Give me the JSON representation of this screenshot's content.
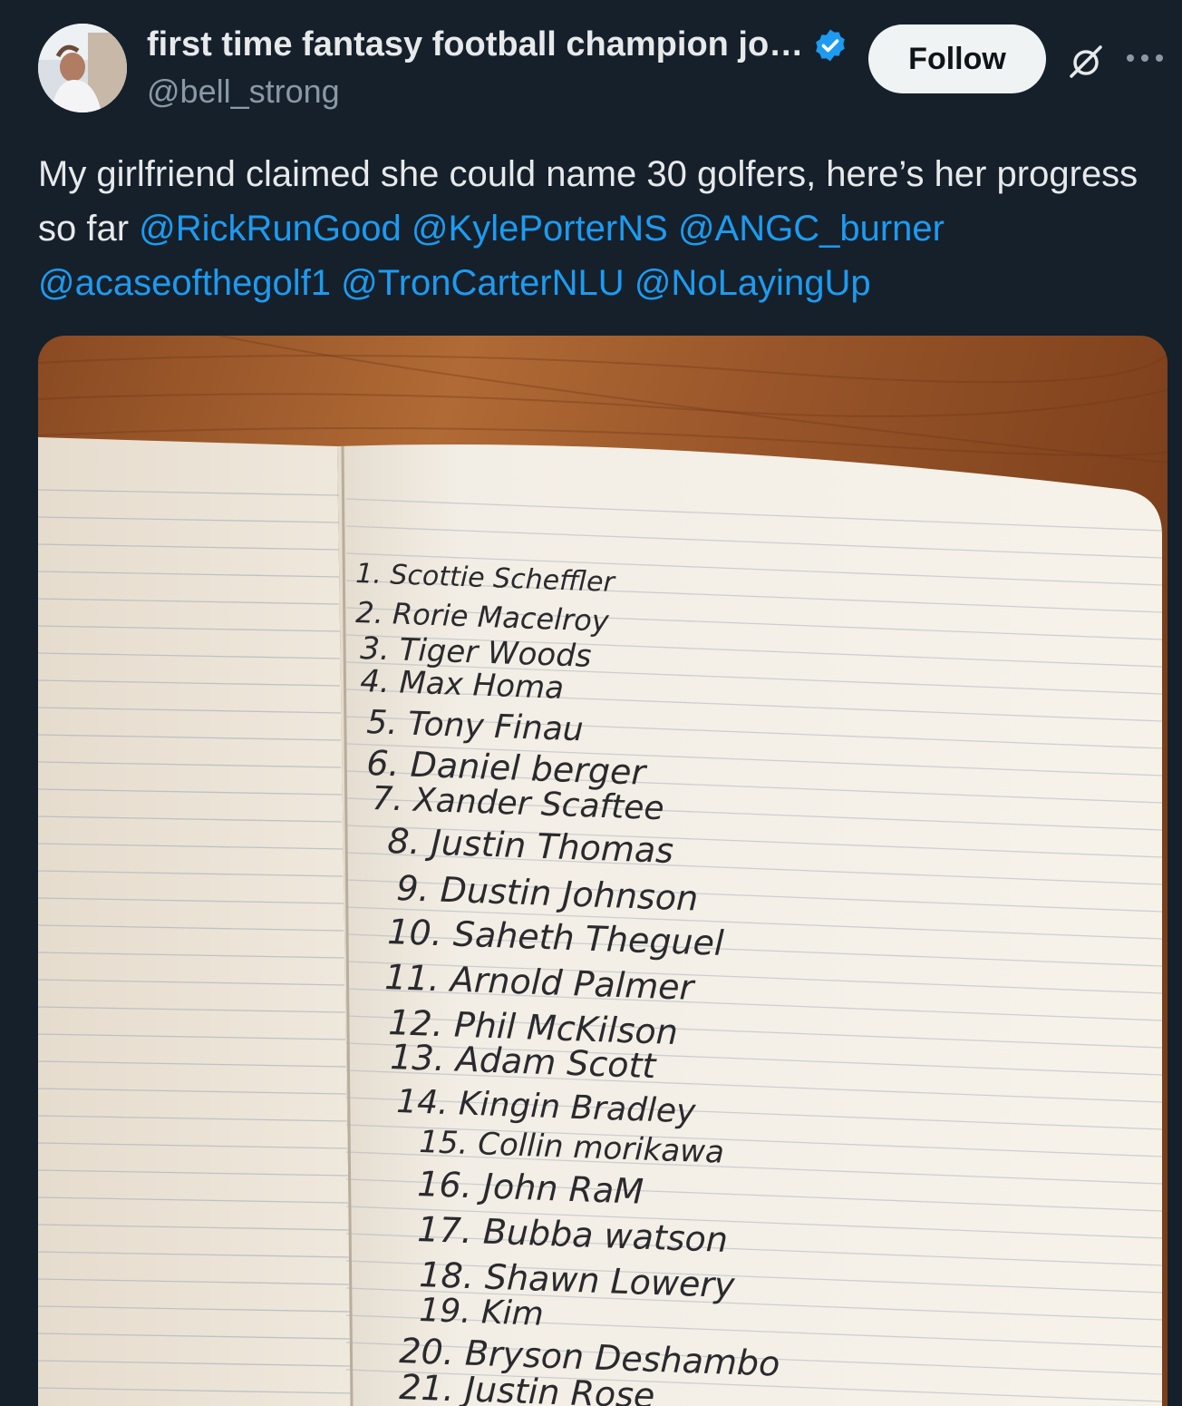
{
  "post": {
    "author": {
      "display_name": "first time fantasy football champion jo…",
      "handle": "@bell_strong"
    },
    "follow_label": "Follow",
    "text_prefix": "My girlfriend claimed she could name 30 golfers, here’s her progress so far",
    "mentions": [
      "@RickRunGood",
      "@KylePorterNS",
      "@ANGC_burner",
      "@acaseofthegolf1",
      "@TronCarterNLU",
      "@NoLayingUp"
    ]
  },
  "image": {
    "handwritten_lines": [
      "1. Scottie Scheffler",
      "2. Rorie Macelroy",
      "3. Tiger Woods",
      "4. Max Homa",
      "5. Tony Finau",
      "6. Daniel berger",
      "7. Xander Scaftee",
      "8. Justin Thomas",
      "9. Dustin Johnson",
      "10. Saheth Theguel",
      "11. Arnold Palmer",
      "12. Phil McKilson",
      "13. Adam Scott",
      "14. Kingin Bradley",
      "15. Collin morikawa",
      "16. John RaM",
      "17. Bubba watson",
      "18. Shawn Lowery",
      "19. Kim",
      "20. Bryson Deshambo",
      "21. Justin Rose"
    ]
  },
  "colors": {
    "background": "#15202b",
    "accent": "#1d9bf0",
    "verified": "#1d9bf0"
  },
  "icons": [
    "avatar-photo",
    "verified-badge-icon",
    "grok-icon",
    "more-icon"
  ]
}
